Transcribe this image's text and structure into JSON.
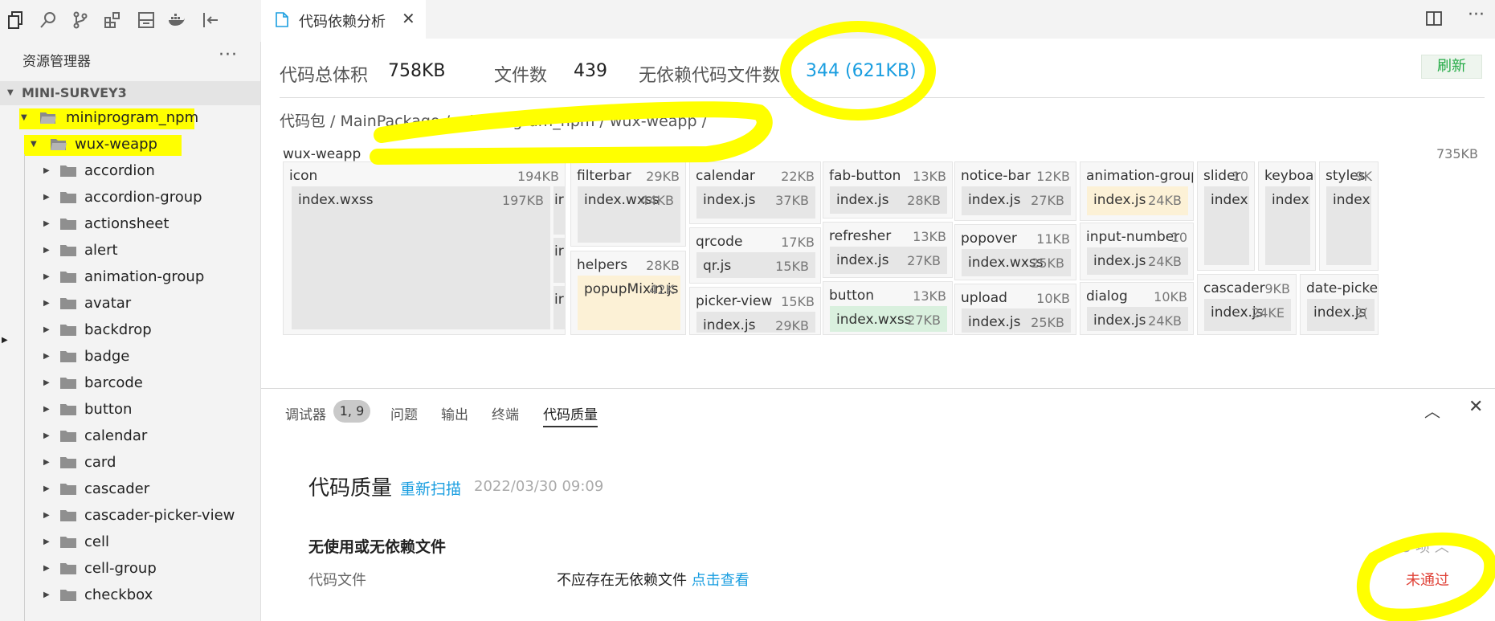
{
  "colors": {
    "accent": "#1a9ee0",
    "refresh": "#22aa44",
    "fail": "#e0443a",
    "highlight": "#ffff00"
  },
  "activity_bar": {
    "icons": [
      "explorer-icon",
      "search-icon",
      "source-control-icon",
      "extensions-icon",
      "storage-icon",
      "docker-icon",
      "collapse-panel-icon"
    ]
  },
  "sidebar": {
    "title": "资源管理器",
    "more": "···",
    "project": "MINI-SURVEY3",
    "items": [
      {
        "label": "miniprogram_npm",
        "open": true
      },
      {
        "label": "wux-weapp",
        "open": true
      },
      {
        "label": "accordion"
      },
      {
        "label": "accordion-group"
      },
      {
        "label": "actionsheet"
      },
      {
        "label": "alert"
      },
      {
        "label": "animation-group"
      },
      {
        "label": "avatar"
      },
      {
        "label": "backdrop"
      },
      {
        "label": "badge"
      },
      {
        "label": "barcode"
      },
      {
        "label": "button"
      },
      {
        "label": "calendar"
      },
      {
        "label": "card"
      },
      {
        "label": "cascader"
      },
      {
        "label": "cascader-picker-view"
      },
      {
        "label": "cell"
      },
      {
        "label": "cell-group"
      },
      {
        "label": "checkbox"
      }
    ]
  },
  "tabs": {
    "active_title": "代码依赖分析",
    "close": "✕",
    "more": "···"
  },
  "summary": {
    "total_label": "代码总体积",
    "total_value": "758KB",
    "files_label": "文件数",
    "files_value": "439",
    "nodep_label": "无依赖代码文件数",
    "nodep_value": "344 (621KB)",
    "refresh": "刷新"
  },
  "breadcrumb": "代码包 / MainPackage / miniprogram_npm / wux-weapp /",
  "treemap": {
    "root": {
      "name": "wux-weapp",
      "size": "735KB"
    },
    "groups": [
      {
        "name": "icon",
        "size": "194KB",
        "files": [
          {
            "name": "index.wxss",
            "size": "197KB"
          },
          {
            "name": "ir"
          },
          {
            "name": "ir"
          },
          {
            "name": "ir"
          }
        ]
      },
      {
        "name": "filterbar",
        "size": "29KB",
        "files": [
          {
            "name": "index.wxss",
            "size": "44KB"
          }
        ]
      },
      {
        "name": "helpers",
        "size": "28KB",
        "files": [
          {
            "name": "popupMixin.js",
            "size": "42K"
          }
        ]
      },
      {
        "name": "calendar",
        "size": "22KB",
        "files": [
          {
            "name": "index.js",
            "size": "37KB"
          }
        ]
      },
      {
        "name": "qrcode",
        "size": "17KB",
        "files": [
          {
            "name": "qr.js",
            "size": "15KB"
          }
        ]
      },
      {
        "name": "picker-view",
        "size": "15KB",
        "files": [
          {
            "name": "index.js",
            "size": "29KB"
          }
        ]
      },
      {
        "name": "fab-button",
        "size": "13KB",
        "files": [
          {
            "name": "index.js",
            "size": "28KB"
          }
        ]
      },
      {
        "name": "refresher",
        "size": "13KB",
        "files": [
          {
            "name": "index.js",
            "size": "27KB"
          }
        ]
      },
      {
        "name": "button",
        "size": "13KB",
        "files": [
          {
            "name": "index.wxss",
            "size": "27KB"
          }
        ]
      },
      {
        "name": "notice-bar",
        "size": "12KB",
        "files": [
          {
            "name": "index.js",
            "size": "27KB"
          }
        ]
      },
      {
        "name": "popover",
        "size": "11KB",
        "files": [
          {
            "name": "index.wxss",
            "size": "25KB"
          }
        ]
      },
      {
        "name": "upload",
        "size": "10KB",
        "files": [
          {
            "name": "index.js",
            "size": "25KB"
          }
        ]
      },
      {
        "name": "animation-group",
        "size": "",
        "files": [
          {
            "name": "index.js",
            "size": "24KB"
          }
        ]
      },
      {
        "name": "input-number",
        "size": "10",
        "files": [
          {
            "name": "index.js",
            "size": "24KB"
          }
        ]
      },
      {
        "name": "dialog",
        "size": "10KB",
        "files": [
          {
            "name": "index.js",
            "size": "24KB"
          }
        ]
      },
      {
        "name": "slider",
        "size": "10",
        "files": [
          {
            "name": "index."
          }
        ]
      },
      {
        "name": "keyboar",
        "size": "",
        "files": [
          {
            "name": "index."
          }
        ]
      },
      {
        "name": "styles",
        "size": "9K",
        "files": [
          {
            "name": "index."
          }
        ]
      },
      {
        "name": "cascader",
        "size": "9KB",
        "files": [
          {
            "name": "index.js",
            "size": "24KE"
          }
        ]
      },
      {
        "name": "date-picker",
        "size": "",
        "files": [
          {
            "name": "index.js",
            "size": "2("
          }
        ]
      }
    ]
  },
  "panel": {
    "tabs": [
      "调试器",
      "问题",
      "输出",
      "终端",
      "代码质量"
    ],
    "badge": "1, 9",
    "chevron": "︿",
    "close": "✕"
  },
  "code_quality": {
    "title": "代码质量",
    "rescan": "重新扫描",
    "time": "2022/03/30 09:09",
    "section": "无使用或无依赖文件",
    "count": "3 项",
    "file_label": "代码文件",
    "message": "不应存在无依赖文件",
    "view": "点击查看",
    "status": "未通过"
  }
}
